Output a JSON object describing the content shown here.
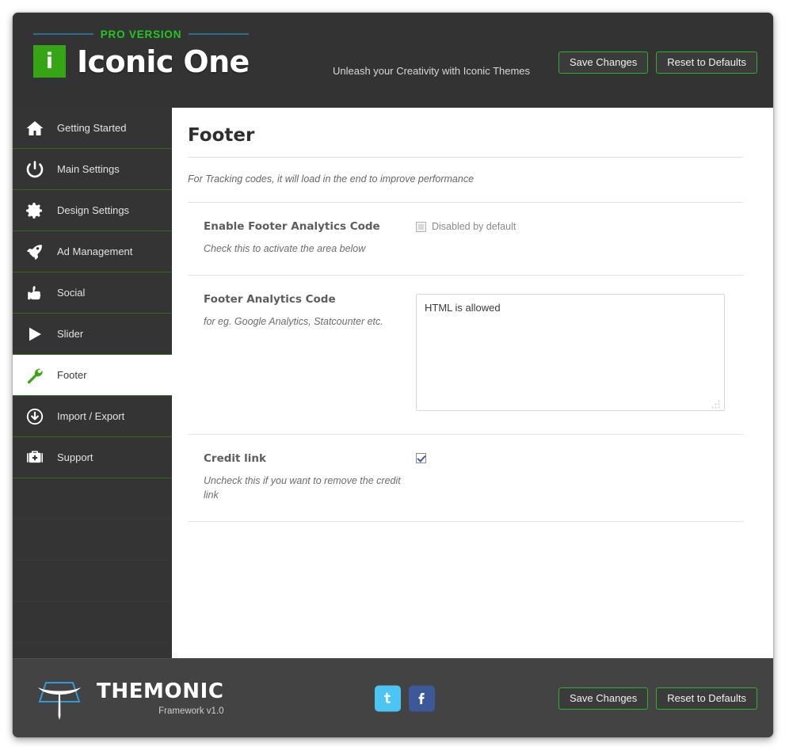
{
  "header": {
    "pro_label": "PRO  VERSION",
    "logo_badge": "i",
    "logo_title": "Iconic One",
    "tagline": "Unleash your Creativity with Iconic Themes",
    "save_label": "Save Changes",
    "reset_label": "Reset to Defaults"
  },
  "sidebar": {
    "items": [
      {
        "label": "Getting Started",
        "icon": "home-icon",
        "active": false
      },
      {
        "label": "Main Settings",
        "icon": "power-icon",
        "active": false
      },
      {
        "label": "Design Settings",
        "icon": "gear-icon",
        "active": false
      },
      {
        "label": "Ad Management",
        "icon": "rocket-icon",
        "active": false
      },
      {
        "label": "Social",
        "icon": "thumbs-up-icon",
        "active": false
      },
      {
        "label": "Slider",
        "icon": "play-icon",
        "active": false
      },
      {
        "label": "Footer",
        "icon": "wrench-icon",
        "active": true
      },
      {
        "label": "Import / Export",
        "icon": "download-circle-icon",
        "active": false
      },
      {
        "label": "Support",
        "icon": "first-aid-kit-icon",
        "active": false
      }
    ]
  },
  "main": {
    "title": "Footer",
    "description": "For Tracking codes, it will load in the end to improve performance",
    "rows": [
      {
        "title": "Enable Footer Analytics Code",
        "desc": "Check this to activate the area below",
        "checkbox_label": "Disabled by default",
        "checked": false
      },
      {
        "title": "Footer Analytics Code",
        "desc": "for eg. Google Analytics, Statcounter etc.",
        "textarea_value": "HTML is allowed"
      },
      {
        "title": "Credit link",
        "desc": "Uncheck this if you want to remove the credit link",
        "checked": true
      }
    ]
  },
  "footer": {
    "brand_name": "THEMONIC",
    "brand_sub": "Framework v1.0",
    "twitter_label": "t",
    "facebook_label": "f",
    "save_label": "Save Changes",
    "reset_label": "Reset to Defaults"
  },
  "colors": {
    "accent_green": "#22c81e",
    "badge_green": "#35a516",
    "rule_blue": "#2b6f8e",
    "twitter_blue": "#4cc5f2",
    "facebook_blue": "#3b5998",
    "dark_bg": "#333333",
    "sidebar_bg": "#343434",
    "footer_bg": "#434343"
  }
}
